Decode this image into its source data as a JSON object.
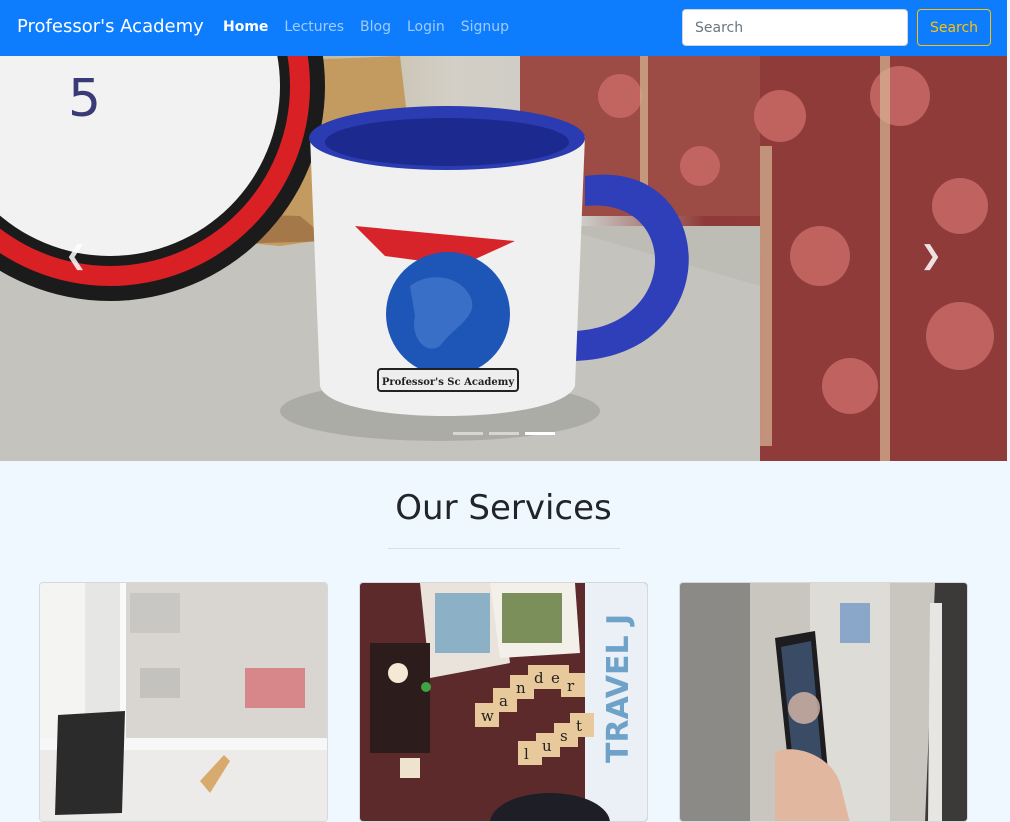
{
  "navbar": {
    "brand": "Professor's Academy",
    "links": [
      {
        "label": "Home",
        "active": true
      },
      {
        "label": "Lectures",
        "active": false
      },
      {
        "label": "Blog",
        "active": false
      },
      {
        "label": "Login",
        "active": false
      },
      {
        "label": "Signup",
        "active": false
      }
    ],
    "search_placeholder": "Search",
    "search_button": "Search"
  },
  "carousel": {
    "slide_count": 3,
    "active_index": 2,
    "prev_icon": "chevron-left-icon",
    "next_icon": "chevron-right-icon",
    "clock_digit": "5",
    "mug_logo_text": "Professor's Sc Academy"
  },
  "services": {
    "title": "Our Services",
    "cards": [
      {
        "image": "laptop-by-window-photo"
      },
      {
        "image": "wander-lust-travel-photo",
        "blocks_text": [
          "w",
          "a",
          "n",
          "d",
          "e",
          "r",
          "l",
          "u",
          "s",
          "t"
        ],
        "side_text": "TRAVEL J"
      },
      {
        "image": "phone-in-hand-photo"
      }
    ]
  },
  "colors": {
    "navbar_bg": "#0d7dfd",
    "accent": "#ffc107",
    "page_bg": "#f0f8ff"
  }
}
